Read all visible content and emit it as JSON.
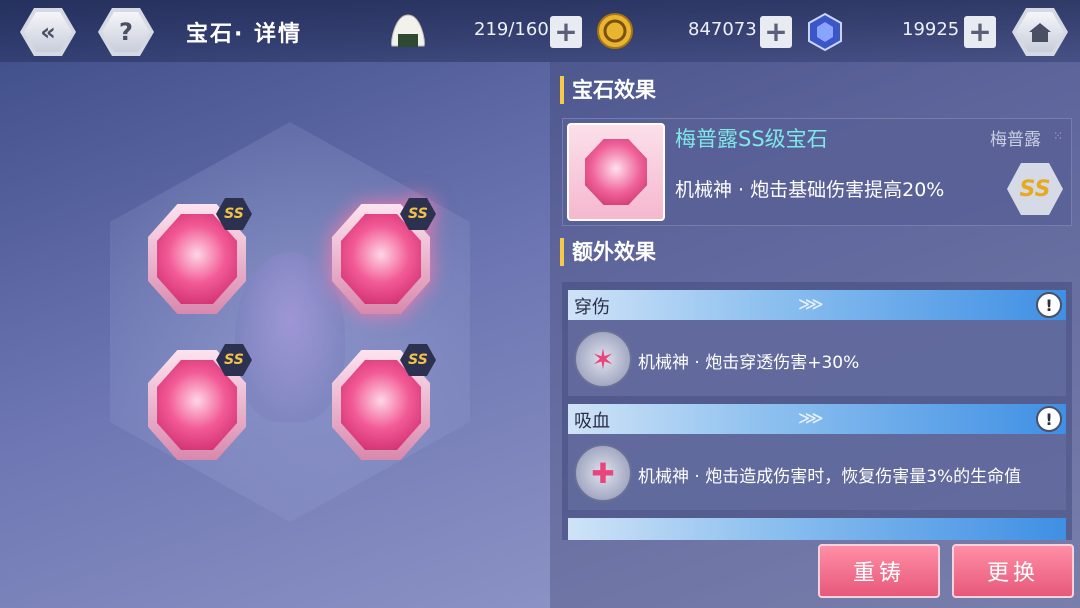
{
  "header": {
    "title": "宝石· 详情",
    "stamina": "219/160",
    "gold": "847073",
    "crystal": "19925"
  },
  "gem_slots": [
    {
      "badge": "SS",
      "selected": false
    },
    {
      "badge": "SS",
      "selected": true
    },
    {
      "badge": "SS",
      "selected": false
    },
    {
      "badge": "SS",
      "selected": false
    }
  ],
  "gem_effect": {
    "section_title": "宝石效果",
    "gem_name": "梅普露SS级宝石",
    "owner": "梅普露",
    "owner_more": "⁙",
    "effect": "机械神 · 炮击基础伤害提高20%",
    "rank": "SS"
  },
  "extra_effect": {
    "section_title": "额外效果",
    "items": [
      {
        "name": "穿伤",
        "info": "!",
        "desc": "机械神 · 炮击穿透伤害+30%"
      },
      {
        "name": "吸血",
        "info": "!",
        "desc": "机械神 · 炮击造成伤害时，恢复伤害量3%的生命值"
      }
    ]
  },
  "actions": {
    "recast": "重铸",
    "replace": "更换"
  },
  "colors": {
    "accent_gold": "#f7c948",
    "gem_pink": "#f25a95",
    "button_pink": "#e7587a",
    "name_cyan": "#7fe8e6"
  }
}
